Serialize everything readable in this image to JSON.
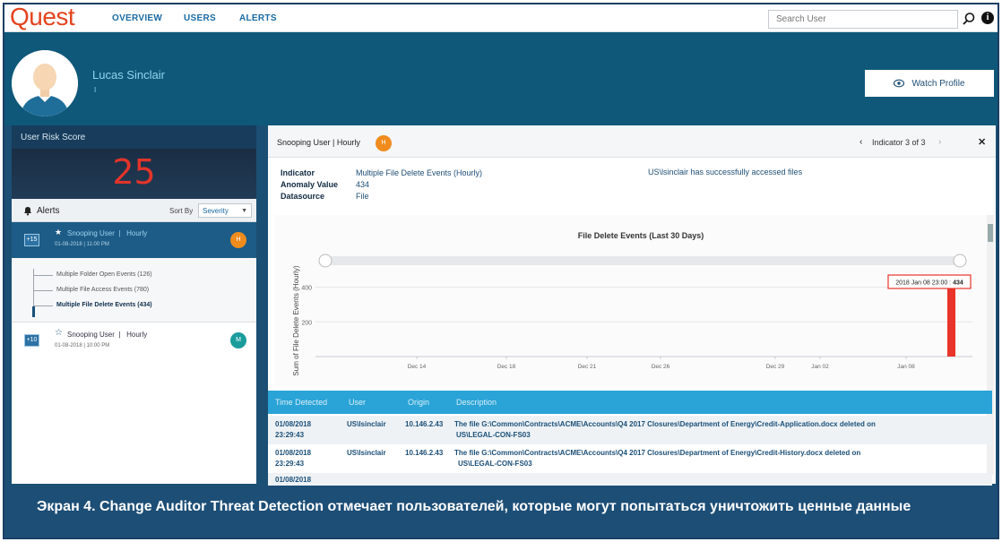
{
  "topbar": {
    "logo": "Quest",
    "nav": [
      "OVERVIEW",
      "USERS",
      "ALERTS"
    ],
    "search_placeholder": "Search User"
  },
  "header": {
    "user_name": "Lucas Sinclair",
    "user_sub": "I",
    "watch_label": "Watch Profile"
  },
  "left": {
    "risk_title": "User Risk Score",
    "risk_score": "25",
    "alerts_label": "Alerts",
    "sort_by_label": "Sort By",
    "sort_value": "Severity",
    "alert1": {
      "count": "+15",
      "title": "Snooping User  |   Hourly",
      "date": "01-08-2018 | 11:00 PM",
      "severity": "H"
    },
    "tree": [
      "Multiple Folder Open Events (126)",
      "Multiple File Access Events (780)",
      "Multiple File Delete Events (434)"
    ],
    "alert2": {
      "count": "+10",
      "title": "Snooping User  |   Hourly",
      "date": "01-08-2018 | 10:00 PM",
      "severity": "M"
    }
  },
  "right": {
    "head_title": "Snooping User | Hourly",
    "head_badge": "H",
    "indicator_label": "Indicator 3 of 3",
    "meta": {
      "indicator_label": "Indicator",
      "indicator_value": "Multiple File Delete Events (Hourly)",
      "anomaly_label": "Anomaly Value",
      "anomaly_value": "434",
      "datasource_label": "Datasource",
      "datasource_value": "File"
    },
    "access_msg": "US\\lsinclair has successfully accessed files",
    "table": {
      "headers": [
        "Time Detected",
        "User",
        "Origin",
        "Description"
      ],
      "rows": [
        {
          "time1": "01/08/2018",
          "time2": "23:29:43",
          "user": "US\\lsinclair",
          "origin": "10.146.2.43",
          "desc1": "The file G:\\Common\\Contracts\\ACME\\Accounts\\Q4 2017 Closures\\Department of Energy\\Credit-Application.docx deleted on",
          "desc2": "US\\LEGAL-CON-FS03"
        },
        {
          "time1": "01/08/2018",
          "time2": "23:29:43",
          "user": "US\\lsinclair",
          "origin": "10.146.2.43",
          "desc1": "The file G:\\Common\\Contracts\\ACME\\Accounts\\Q4 2017 Closures\\Department of Energy\\Credit-History.docx deleted on",
          "desc2": "US\\LEGAL-CON-FS03"
        },
        {
          "time1": "01/08/2018",
          "time2": "",
          "user": "",
          "origin": "",
          "desc1": "",
          "desc2": ""
        }
      ]
    }
  },
  "chart_data": {
    "type": "bar",
    "title": "File Delete Events (Last 30 Days)",
    "ylabel": "Sum of File Delete Events (Hourly)",
    "xlabel": "",
    "x_ticks": [
      "Dec 14",
      "Dec 18",
      "Dec 21",
      "Dec 26",
      "Dec 29",
      "Jan 02",
      "Jan 08"
    ],
    "y_ticks": [
      200,
      400
    ],
    "ylim": [
      0,
      520
    ],
    "categories": [
      "2018 Jan 08 23:00"
    ],
    "values": [
      434
    ],
    "tooltip": "2018 Jan 08 23:00 : 434",
    "bar_color": "#e8342a"
  },
  "caption": "Экран 4. Change Auditor Threat Detection отмечает пользователей, которые могут попытаться уничтожить ценные данные",
  "colors": {
    "brand": "#e4431f",
    "header": "#0f5879",
    "accent": "#2aa3d6",
    "risk": "#e2342a"
  }
}
